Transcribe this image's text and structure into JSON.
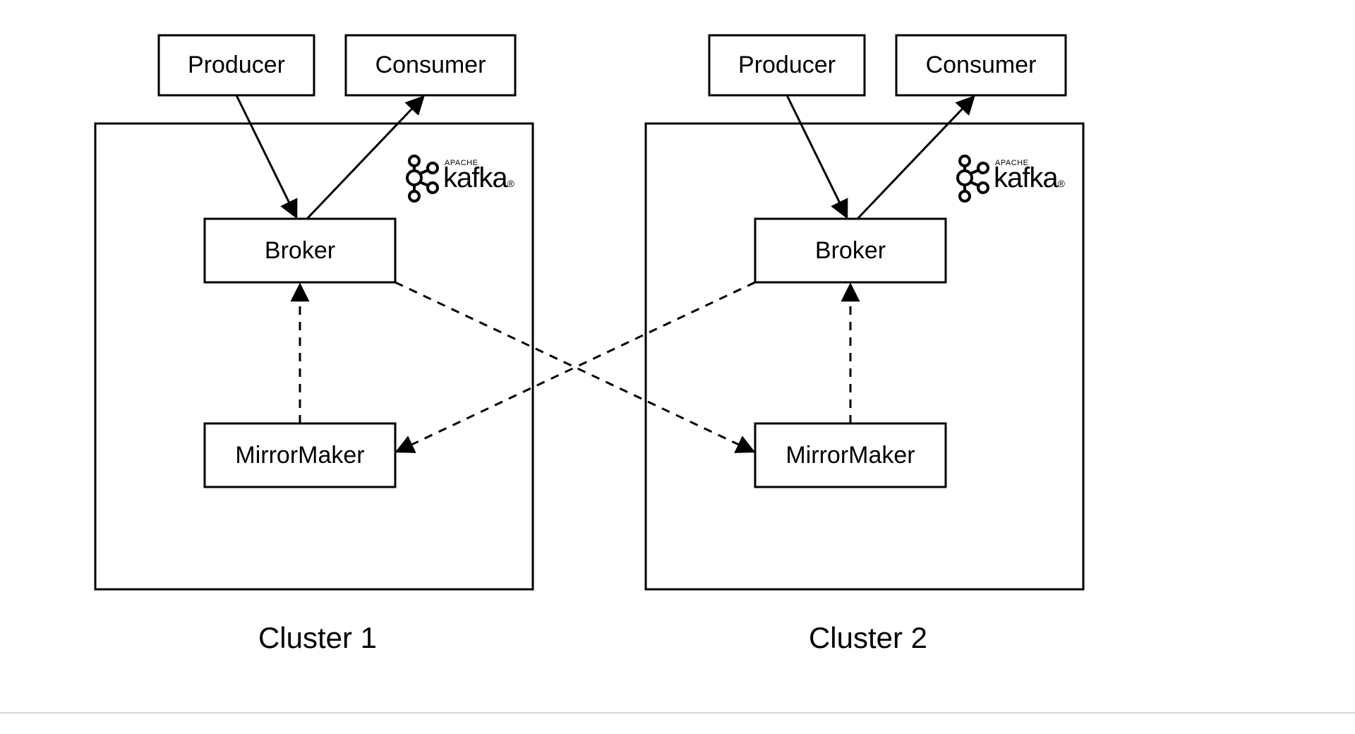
{
  "clusters": [
    {
      "label": "Cluster 1",
      "producer": "Producer",
      "consumer": "Consumer",
      "broker": "Broker",
      "mirrormaker": "MirrorMaker",
      "brand_small": "APACHE",
      "brand_big": "kafka",
      "brand_mark": "®"
    },
    {
      "label": "Cluster 2",
      "producer": "Producer",
      "consumer": "Consumer",
      "broker": "Broker",
      "mirrormaker": "MirrorMaker",
      "brand_small": "APACHE",
      "brand_big": "kafka",
      "brand_mark": "®"
    }
  ]
}
